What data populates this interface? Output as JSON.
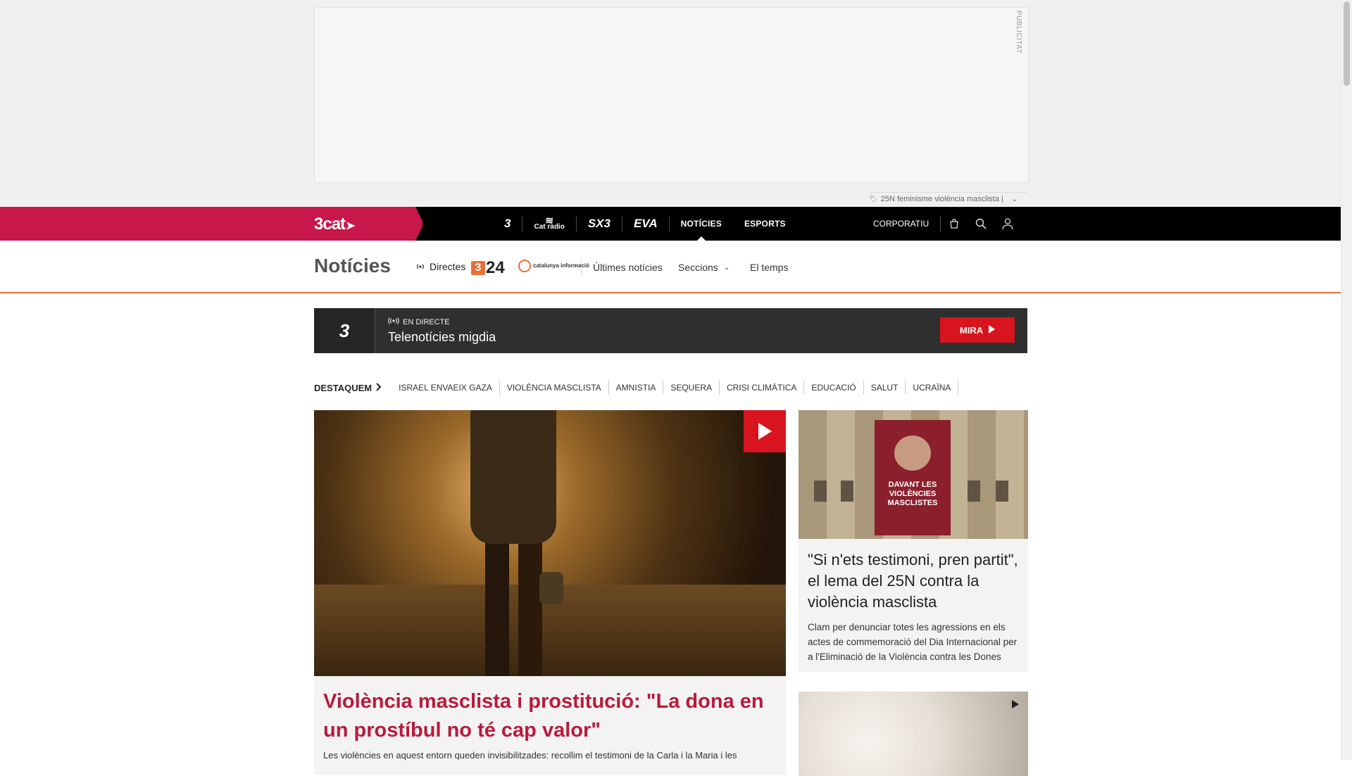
{
  "ad": {
    "label": "PUBLICITAT",
    "tagline": "25N feminisme violència masclista |"
  },
  "topnav": {
    "brand": "3cat",
    "channels": [
      {
        "label": "3",
        "name": "channel-3"
      },
      {
        "label": "Cat ràdio",
        "name": "channel-catradio"
      },
      {
        "label": "SX3",
        "name": "channel-sx3"
      },
      {
        "label": "EVA",
        "name": "channel-eva"
      }
    ],
    "links": [
      "NOTÍCIES",
      "ESPORTS"
    ],
    "corporate": "CORPORATIU",
    "icons": [
      "shop-icon",
      "search-icon",
      "user-icon"
    ]
  },
  "subnav": {
    "title": "Notícies",
    "directes": "Directes",
    "channel_324": "24",
    "channel_324_badge": "3",
    "cat_info": "catalunya informació",
    "links": [
      "Últimes notícies",
      "Seccions",
      "El temps"
    ]
  },
  "live": {
    "logo": "3",
    "tag": "EN DIRECTE",
    "title": "Telenotícies migdia",
    "button": "MIRA"
  },
  "destaquem": {
    "label": "DESTAQUEM",
    "tags": [
      "ISRAEL ENVAEIX GAZA",
      "VIOLÈNCIA MASCLISTA",
      "AMNISTIA",
      "SEQUERA",
      "CRISI CLIMÀTICA",
      "EDUCACIÓ",
      "SALUT",
      "UCRAÏNA"
    ]
  },
  "hero": {
    "title": "Violència masclista i prostitució: \"La dona en un prostíbul no té cap valor\"",
    "desc": "Les violències en aquest entorn queden invisibilitzades: recollim el testimoni de la Carla i la Maria i les"
  },
  "side": {
    "banner_text": "DAVANT LES VIOLÈNCIES MASCLISTES",
    "title": "\"Si n'ets testimoni, pren partit\", el lema del 25N contra la violència masclista",
    "desc": "Clam per denunciar totes les agressions en els actes de commemoració del Dia Internacional per a l'Eliminació de la Violència contra les Dones"
  },
  "colors": {
    "brand": "#c8174a",
    "accent": "#e8703a",
    "live_red": "#d8141f",
    "headline": "#b81b3c"
  }
}
